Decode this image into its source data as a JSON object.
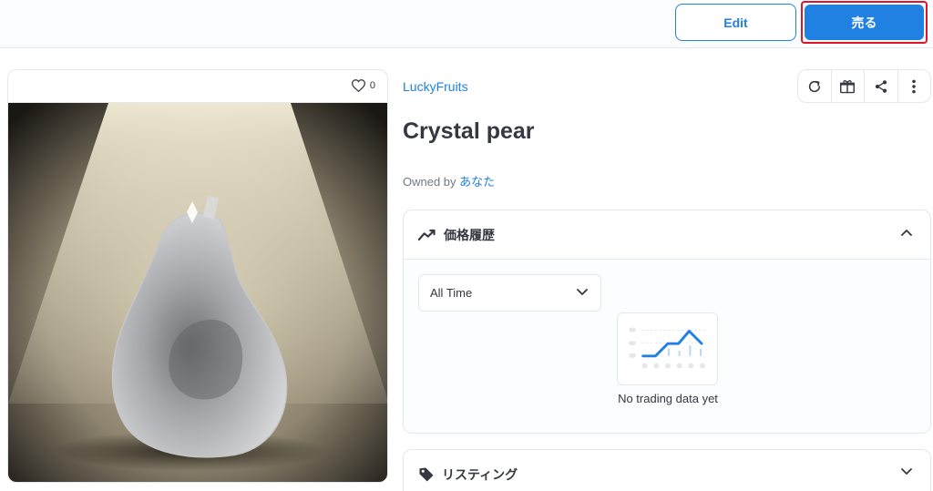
{
  "toolbar": {
    "edit_label": "Edit",
    "sell_label": "売る"
  },
  "media": {
    "favorite_count": "0",
    "image_subject": "crystal pear under spotlight"
  },
  "item": {
    "collection": "LuckyFruits",
    "name": "Crystal pear",
    "owned_by_label": "Owned by",
    "owner": "あなた"
  },
  "actions": [
    {
      "icon": "refresh-icon"
    },
    {
      "icon": "gift-icon"
    },
    {
      "icon": "share-icon"
    },
    {
      "icon": "more-vertical-icon"
    }
  ],
  "price_history": {
    "title": "価格履歴",
    "range_selected": "All Time",
    "empty_message": "No trading data yet"
  },
  "listings": {
    "title": "リスティング"
  },
  "colors": {
    "accent": "#2081e2",
    "highlight_border": "#e0142a",
    "text": "#353840",
    "muted": "#707a83"
  }
}
